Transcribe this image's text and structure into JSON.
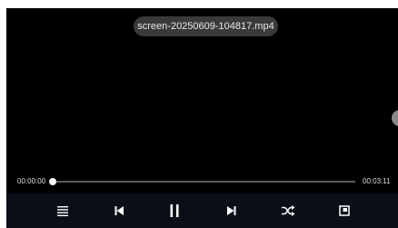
{
  "player": {
    "file_name": "screen-20250609-104817.mp4",
    "time_current": "00:00:00",
    "time_total": "00:03:11",
    "progress": 0.0,
    "state": "playing"
  },
  "controls": {
    "icons": [
      "playlist-icon",
      "previous-icon",
      "pause-icon",
      "next-icon",
      "shuffle-icon",
      "picture-in-picture-icon"
    ]
  },
  "colors": {
    "screen_background": "#000000",
    "control_bar": "#0a0e17",
    "pill_background": "#3a3a3a",
    "text": "#dcdcdc",
    "track": "#5a5a5a",
    "thumb": "#ffffff"
  }
}
